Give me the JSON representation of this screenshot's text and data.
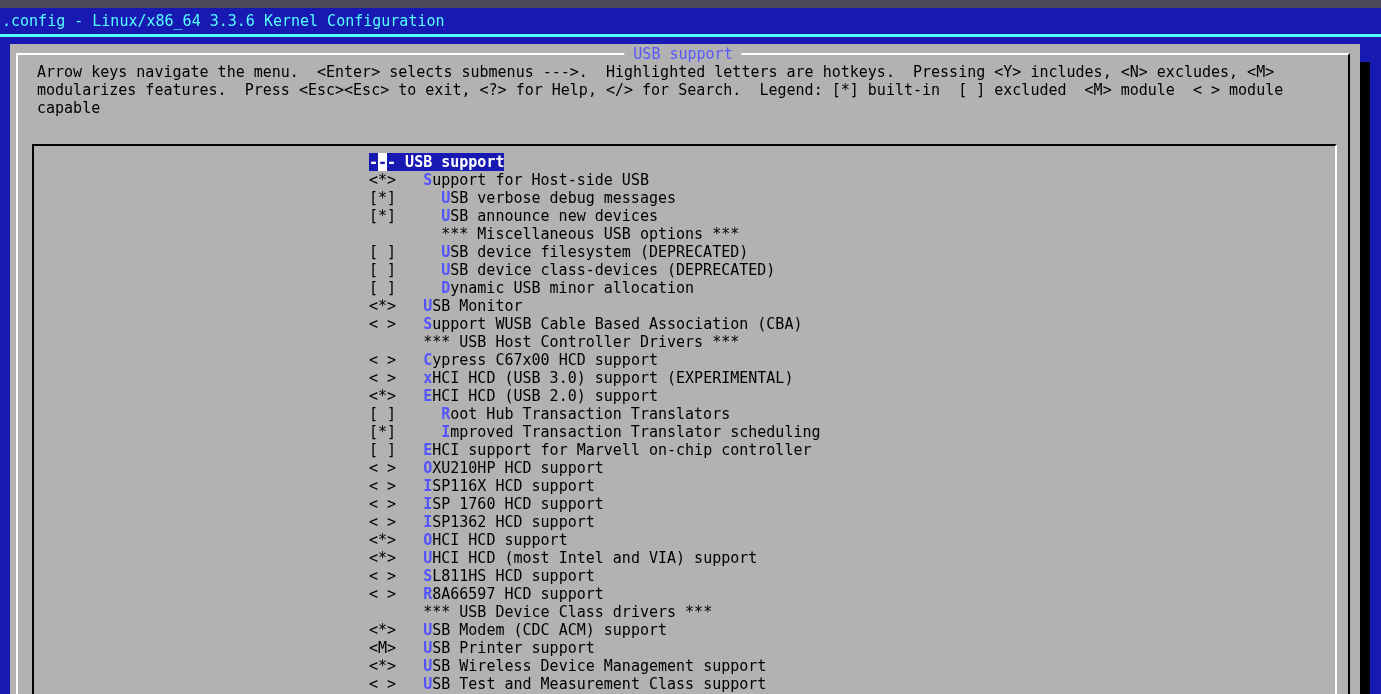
{
  "window": {
    "title": ".config - Linux/x86_64 3.3.6 Kernel Configuration"
  },
  "dialog": {
    "title": "USB support",
    "help": "Arrow keys navigate the menu.  <Enter> selects submenus --->.  Highlighted letters are hotkeys.  Pressing <Y> includes, <N> excludes, <M> modularizes features.  Press <Esc><Esc> to exit, <?> for Help, </> for Search.  Legend: [*] built-in  [ ] excluded  <M> module  < > module capable"
  },
  "items": [
    {
      "kind": "menu",
      "prompt": "---",
      "label": "USB support",
      "selected": true,
      "cursor": true
    },
    {
      "kind": "option",
      "prompt": "<*>",
      "hotkey": "S",
      "label": "upport for Host-side USB",
      "selected": false,
      "children": [
        {
          "kind": "option",
          "prompt": "[*]",
          "hotkey": "U",
          "label": "SB verbose debug messages",
          "selected": false
        },
        {
          "kind": "option",
          "prompt": "[*]",
          "hotkey": "U",
          "label": "SB announce new devices",
          "selected": false
        },
        {
          "kind": "comment",
          "label": "*** Miscellaneous USB options ***",
          "selected": false
        },
        {
          "kind": "option",
          "prompt": "[ ]",
          "hotkey": "U",
          "label": "SB device filesystem (DEPRECATED)",
          "selected": false
        },
        {
          "kind": "option",
          "prompt": "[ ]",
          "hotkey": "U",
          "label": "SB device class-devices (DEPRECATED)",
          "selected": false
        },
        {
          "kind": "option",
          "prompt": "[ ]",
          "hotkey": "D",
          "label": "ynamic USB minor allocation",
          "selected": false
        }
      ]
    },
    {
      "kind": "option",
      "prompt": "<*>",
      "hotkey": "U",
      "label": "SB Monitor",
      "selected": false
    },
    {
      "kind": "option",
      "prompt": "< >",
      "hotkey": "S",
      "label": "upport WUSB Cable Based Association (CBA)",
      "selected": false
    },
    {
      "kind": "comment",
      "label": "*** USB Host Controller Drivers ***",
      "selected": false
    },
    {
      "kind": "option",
      "prompt": "< >",
      "hotkey": "C",
      "label": "ypress C67x00 HCD support",
      "selected": false
    },
    {
      "kind": "option",
      "prompt": "< >",
      "hotkey": "x",
      "label": "HCI HCD (USB 3.0) support (EXPERIMENTAL)",
      "selected": false
    },
    {
      "kind": "option",
      "prompt": "<*>",
      "hotkey": "E",
      "label": "HCI HCD (USB 2.0) support",
      "selected": false,
      "children": [
        {
          "kind": "option",
          "prompt": "[ ]",
          "hotkey": "R",
          "label": "oot Hub Transaction Translators",
          "selected": false
        },
        {
          "kind": "option",
          "prompt": "[*]",
          "hotkey": "I",
          "label": "mproved Transaction Translator scheduling",
          "selected": false
        }
      ]
    },
    {
      "kind": "option",
      "prompt": "[ ]",
      "hotkey": "E",
      "label": "HCI support for Marvell on-chip controller",
      "selected": false
    },
    {
      "kind": "option",
      "prompt": "< >",
      "hotkey": "O",
      "label": "XU210HP HCD support",
      "selected": false
    },
    {
      "kind": "option",
      "prompt": "< >",
      "hotkey": "I",
      "label": "SP116X HCD support",
      "selected": false
    },
    {
      "kind": "option",
      "prompt": "< >",
      "hotkey": "I",
      "label": "SP 1760 HCD support",
      "selected": false
    },
    {
      "kind": "option",
      "prompt": "< >",
      "hotkey": "I",
      "label": "SP1362 HCD support",
      "selected": false
    },
    {
      "kind": "option",
      "prompt": "<*>",
      "hotkey": "O",
      "label": "HCI HCD support",
      "selected": false
    },
    {
      "kind": "option",
      "prompt": "<*>",
      "hotkey": "U",
      "label": "HCI HCD (most Intel and VIA) support",
      "selected": false
    },
    {
      "kind": "option",
      "prompt": "< >",
      "hotkey": "S",
      "label": "L811HS HCD support",
      "selected": false
    },
    {
      "kind": "option",
      "prompt": "< >",
      "hotkey": "R",
      "label": "8A66597 HCD support",
      "selected": false
    },
    {
      "kind": "comment",
      "label": "*** USB Device Class drivers ***",
      "selected": false
    },
    {
      "kind": "option",
      "prompt": "<*>",
      "hotkey": "U",
      "label": "SB Modem (CDC ACM) support",
      "selected": false
    },
    {
      "kind": "option",
      "prompt": "<M>",
      "hotkey": "U",
      "label": "SB Printer support",
      "selected": false
    },
    {
      "kind": "option",
      "prompt": "<*>",
      "hotkey": "U",
      "label": "SB Wireless Device Management support",
      "selected": false
    },
    {
      "kind": "option",
      "prompt": "< >",
      "hotkey": "U",
      "label": "SB Test and Measurement Class support",
      "selected": false
    }
  ]
}
